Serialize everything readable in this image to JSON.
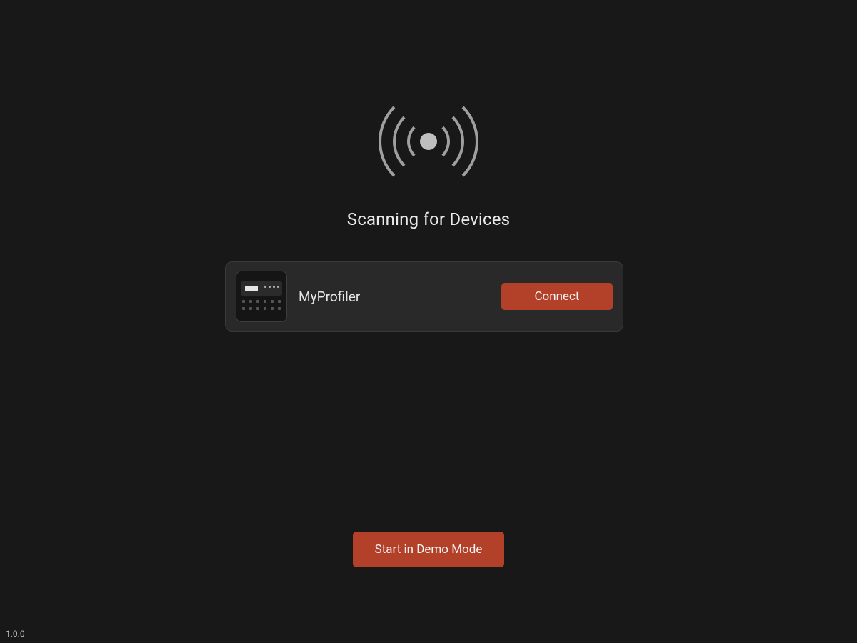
{
  "scan": {
    "title": "Scanning for Devices"
  },
  "devices": [
    {
      "name": "MyProfiler",
      "connect_label": "Connect"
    }
  ],
  "demo": {
    "label": "Start in Demo Mode"
  },
  "footer": {
    "version": "1.0.0"
  },
  "colors": {
    "accent": "#b34129",
    "background": "#181818",
    "card": "#292929"
  }
}
